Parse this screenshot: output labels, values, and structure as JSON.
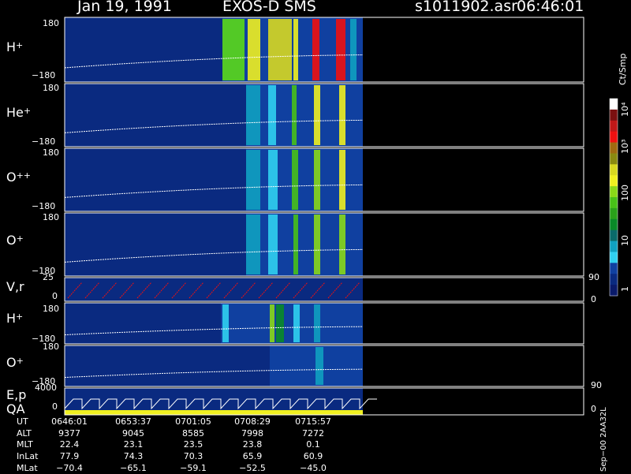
{
  "header": {
    "date": "Jan 19, 1991",
    "instrument": "EXOS-D SMS",
    "file": "s1011902.asr",
    "time": "06:46:01"
  },
  "panels": [
    {
      "species": "H",
      "charge": "+",
      "ymax": "180",
      "ymin": "−180"
    },
    {
      "species": "He",
      "charge": "+",
      "ymax": "180",
      "ymin": "−180"
    },
    {
      "species": "O",
      "charge": "++",
      "ymax": "180",
      "ymin": "−180"
    },
    {
      "species": "O",
      "charge": "+",
      "ymax": "180",
      "ymin": "−180"
    },
    {
      "species": "V,r",
      "charge": "",
      "ymax": "25",
      "ymin": "0",
      "right_top": "90",
      "right_bottom": "0"
    },
    {
      "species": "H",
      "charge": "+",
      "ymax": "180",
      "ymin": "−180"
    },
    {
      "species": "O",
      "charge": "+",
      "ymax": "180",
      "ymin": "−180",
      "right_bottom": "90"
    },
    {
      "species": "E,p",
      "charge": "",
      "species2": "QA",
      "ymax": "4000",
      "ymin": "0",
      "right_bottom": "0"
    }
  ],
  "colorbar": {
    "unit": "Ct/Smp",
    "labels": [
      "10⁴",
      "10³",
      "100",
      "10",
      "1"
    ],
    "colors": [
      "#ffffff",
      "#7a1010",
      "#c01818",
      "#f01010",
      "#a06a10",
      "#8a8a10",
      "#d8d820",
      "#f0f020",
      "#8ad818",
      "#48c018",
      "#2aa01a",
      "#0a8a28",
      "#0a6a6a",
      "#10a0c0",
      "#30d0f0",
      "#1040a0",
      "#0a2a80",
      "#0a1a6a"
    ]
  },
  "table": {
    "rows": [
      {
        "name": "UT",
        "values": [
          "0646:01",
          "0653:37",
          "0701:05",
          "0708:29",
          "0715:57"
        ]
      },
      {
        "name": "ALT",
        "values": [
          "9377",
          "9045",
          "8585",
          "7998",
          "7272"
        ]
      },
      {
        "name": "MLT",
        "values": [
          "22.4",
          "23.1",
          "23.5",
          "23.8",
          "0.1"
        ]
      },
      {
        "name": "InLat",
        "values": [
          "77.9",
          "74.3",
          "70.3",
          "65.9",
          "60.9"
        ]
      },
      {
        "name": "MLat",
        "values": [
          "−70.4",
          "−65.1",
          "−59.1",
          "−52.5",
          "−45.0"
        ]
      }
    ]
  },
  "footer_vertical": "Sep−00  2AA32L",
  "chart_data": {
    "type": "heatmap",
    "x_ticks": [
      "0646:01",
      "0653:37",
      "0701:05",
      "0708:29",
      "0715:57"
    ],
    "y_range_pitch_angle": [
      -180,
      180
    ],
    "colorscale": "log",
    "colorscale_range": [
      1,
      10000
    ],
    "active_interval_fraction": [
      0.0,
      0.57
    ]
  }
}
